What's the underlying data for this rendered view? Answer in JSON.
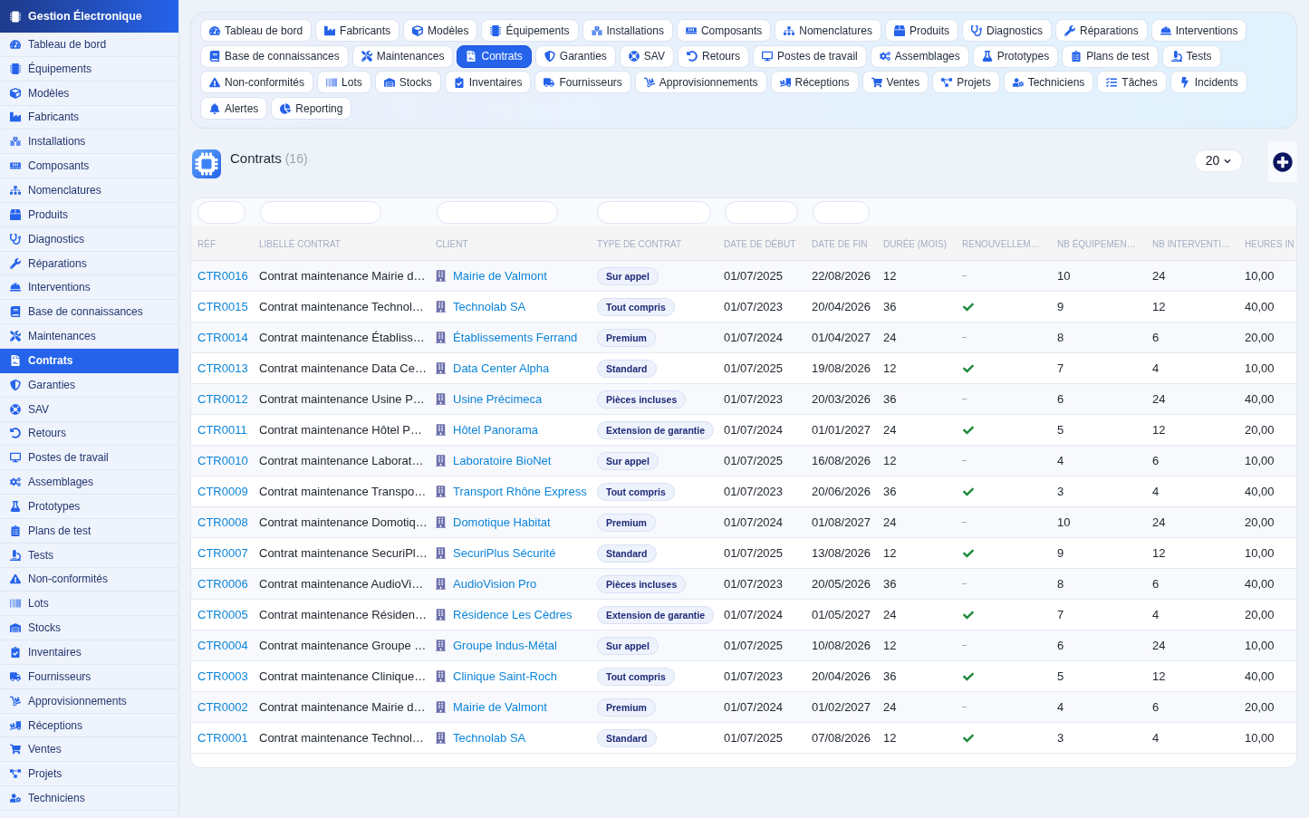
{
  "sidebar": {
    "title": "Gestion Électronique",
    "items": [
      {
        "label": "Tableau de bord",
        "selected": false
      },
      {
        "label": "Équipements",
        "selected": false
      },
      {
        "label": "Modèles",
        "selected": false
      },
      {
        "label": "Fabricants",
        "selected": false
      },
      {
        "label": "Installations",
        "selected": false
      },
      {
        "label": "Composants",
        "selected": false
      },
      {
        "label": "Nomenclatures",
        "selected": false
      },
      {
        "label": "Produits",
        "selected": false
      },
      {
        "label": "Diagnostics",
        "selected": false
      },
      {
        "label": "Réparations",
        "selected": false
      },
      {
        "label": "Interventions",
        "selected": false
      },
      {
        "label": "Base de connaissances",
        "selected": false
      },
      {
        "label": "Maintenances",
        "selected": false
      },
      {
        "label": "Contrats",
        "selected": true
      },
      {
        "label": "Garanties",
        "selected": false
      },
      {
        "label": "SAV",
        "selected": false
      },
      {
        "label": "Retours",
        "selected": false
      },
      {
        "label": "Postes de travail",
        "selected": false
      },
      {
        "label": "Assemblages",
        "selected": false
      },
      {
        "label": "Prototypes",
        "selected": false
      },
      {
        "label": "Plans de test",
        "selected": false
      },
      {
        "label": "Tests",
        "selected": false
      },
      {
        "label": "Non-conformités",
        "selected": false
      },
      {
        "label": "Lots",
        "selected": false
      },
      {
        "label": "Stocks",
        "selected": false
      },
      {
        "label": "Inventaires",
        "selected": false
      },
      {
        "label": "Fournisseurs",
        "selected": false
      },
      {
        "label": "Approvisionnements",
        "selected": false
      },
      {
        "label": "Réceptions",
        "selected": false
      },
      {
        "label": "Ventes",
        "selected": false
      },
      {
        "label": "Projets",
        "selected": false
      },
      {
        "label": "Techniciens",
        "selected": false
      }
    ]
  },
  "tabs": [
    {
      "label": "Tableau de bord",
      "selected": false
    },
    {
      "label": "Fabricants",
      "selected": false
    },
    {
      "label": "Modèles",
      "selected": false
    },
    {
      "label": "Équipements",
      "selected": false
    },
    {
      "label": "Installations",
      "selected": false
    },
    {
      "label": "Composants",
      "selected": false
    },
    {
      "label": "Nomenclatures",
      "selected": false
    },
    {
      "label": "Produits",
      "selected": false
    },
    {
      "label": "Diagnostics",
      "selected": false
    },
    {
      "label": "Réparations",
      "selected": false
    },
    {
      "label": "Interventions",
      "selected": false
    },
    {
      "label": "Base de connaissances",
      "selected": false
    },
    {
      "label": "Maintenances",
      "selected": false
    },
    {
      "label": "Contrats",
      "selected": true
    },
    {
      "label": "Garanties",
      "selected": false
    },
    {
      "label": "SAV",
      "selected": false
    },
    {
      "label": "Retours",
      "selected": false
    },
    {
      "label": "Postes de travail",
      "selected": false
    },
    {
      "label": "Assemblages",
      "selected": false
    },
    {
      "label": "Prototypes",
      "selected": false
    },
    {
      "label": "Plans de test",
      "selected": false
    },
    {
      "label": "Tests",
      "selected": false
    },
    {
      "label": "Non-conformités",
      "selected": false
    },
    {
      "label": "Lots",
      "selected": false
    },
    {
      "label": "Stocks",
      "selected": false
    },
    {
      "label": "Inventaires",
      "selected": false
    },
    {
      "label": "Fournisseurs",
      "selected": false
    },
    {
      "label": "Approvisionnements",
      "selected": false
    },
    {
      "label": "Réceptions",
      "selected": false
    },
    {
      "label": "Ventes",
      "selected": false
    },
    {
      "label": "Projets",
      "selected": false
    },
    {
      "label": "Techniciens",
      "selected": false
    },
    {
      "label": "Tâches",
      "selected": false
    },
    {
      "label": "Incidents",
      "selected": false
    },
    {
      "label": "Alertes",
      "selected": false
    },
    {
      "label": "Reporting",
      "selected": false
    }
  ],
  "heading": {
    "title": "Contrats",
    "count": "(16)"
  },
  "page_size": "20",
  "table": {
    "columns": [
      {
        "label": "RÉF",
        "filter": true
      },
      {
        "label": "LIBELLÉ CONTRAT",
        "filter": true
      },
      {
        "label": "CLIENT",
        "filter": true
      },
      {
        "label": "TYPE DE CONTRAT",
        "filter": true
      },
      {
        "label": "DATE DE DÉBUT",
        "filter": true
      },
      {
        "label": "DATE DE FIN",
        "filter": true
      },
      {
        "label": "DURÉE (MOIS)",
        "filter": false
      },
      {
        "label": "RENOUVELLEM…",
        "filter": false
      },
      {
        "label": "NB ÉQUIPEMEN…",
        "filter": false
      },
      {
        "label": "NB INTERVENTI…",
        "filter": false
      },
      {
        "label": "HEURES IN",
        "filter": false
      }
    ],
    "rows": [
      {
        "ref": "CTR0016",
        "label": "Contrat maintenance Mairie d…",
        "client": "Mairie de Valmont",
        "type": "Sur appel",
        "start_date": "01/07/2025",
        "end_date": "22/08/2026",
        "duration": "12",
        "renewal": false,
        "equipment_count": "10",
        "intervention_count": "24",
        "hours": "10,00"
      },
      {
        "ref": "CTR0015",
        "label": "Contrat maintenance Technol…",
        "client": "Technolab SA",
        "type": "Tout compris",
        "start_date": "01/07/2023",
        "end_date": "20/04/2026",
        "duration": "36",
        "renewal": true,
        "equipment_count": "9",
        "intervention_count": "12",
        "hours": "40,00"
      },
      {
        "ref": "CTR0014",
        "label": "Contrat maintenance Établiss…",
        "client": "Établissements Ferrand",
        "type": "Premium",
        "start_date": "01/07/2024",
        "end_date": "01/04/2027",
        "duration": "24",
        "renewal": false,
        "equipment_count": "8",
        "intervention_count": "6",
        "hours": "20,00"
      },
      {
        "ref": "CTR0013",
        "label": "Contrat maintenance Data Ce…",
        "client": "Data Center Alpha",
        "type": "Standard",
        "start_date": "01/07/2025",
        "end_date": "19/08/2026",
        "duration": "12",
        "renewal": true,
        "equipment_count": "7",
        "intervention_count": "4",
        "hours": "10,00"
      },
      {
        "ref": "CTR0012",
        "label": "Contrat maintenance Usine P…",
        "client": "Usine Précimeca",
        "type": "Pièces incluses",
        "start_date": "01/07/2023",
        "end_date": "20/03/2026",
        "duration": "36",
        "renewal": false,
        "equipment_count": "6",
        "intervention_count": "24",
        "hours": "40,00"
      },
      {
        "ref": "CTR0011",
        "label": "Contrat maintenance Hôtel P…",
        "client": "Hôtel Panorama",
        "type": "Extension de garantie",
        "start_date": "01/07/2024",
        "end_date": "01/01/2027",
        "duration": "24",
        "renewal": true,
        "equipment_count": "5",
        "intervention_count": "12",
        "hours": "20,00"
      },
      {
        "ref": "CTR0010",
        "label": "Contrat maintenance Laborat…",
        "client": "Laboratoire BioNet",
        "type": "Sur appel",
        "start_date": "01/07/2025",
        "end_date": "16/08/2026",
        "duration": "12",
        "renewal": false,
        "equipment_count": "4",
        "intervention_count": "6",
        "hours": "10,00"
      },
      {
        "ref": "CTR0009",
        "label": "Contrat maintenance Transpo…",
        "client": "Transport Rhône Express",
        "type": "Tout compris",
        "start_date": "01/07/2023",
        "end_date": "20/06/2026",
        "duration": "36",
        "renewal": true,
        "equipment_count": "3",
        "intervention_count": "4",
        "hours": "40,00"
      },
      {
        "ref": "CTR0008",
        "label": "Contrat maintenance Domotiq…",
        "client": "Domotique Habitat",
        "type": "Premium",
        "start_date": "01/07/2024",
        "end_date": "01/08/2027",
        "duration": "24",
        "renewal": false,
        "equipment_count": "10",
        "intervention_count": "24",
        "hours": "20,00"
      },
      {
        "ref": "CTR0007",
        "label": "Contrat maintenance SecuriPl…",
        "client": "SecuriPlus Sécurité",
        "type": "Standard",
        "start_date": "01/07/2025",
        "end_date": "13/08/2026",
        "duration": "12",
        "renewal": true,
        "equipment_count": "9",
        "intervention_count": "12",
        "hours": "10,00"
      },
      {
        "ref": "CTR0006",
        "label": "Contrat maintenance AudioVi…",
        "client": "AudioVision Pro",
        "type": "Pièces incluses",
        "start_date": "01/07/2023",
        "end_date": "20/05/2026",
        "duration": "36",
        "renewal": false,
        "equipment_count": "8",
        "intervention_count": "6",
        "hours": "40,00"
      },
      {
        "ref": "CTR0005",
        "label": "Contrat maintenance Résiden…",
        "client": "Résidence Les Cèdres",
        "type": "Extension de garantie",
        "start_date": "01/07/2024",
        "end_date": "01/05/2027",
        "duration": "24",
        "renewal": true,
        "equipment_count": "7",
        "intervention_count": "4",
        "hours": "20,00"
      },
      {
        "ref": "CTR0004",
        "label": "Contrat maintenance Groupe …",
        "client": "Groupe Indus-Métal",
        "type": "Sur appel",
        "start_date": "01/07/2025",
        "end_date": "10/08/2026",
        "duration": "12",
        "renewal": false,
        "equipment_count": "6",
        "intervention_count": "24",
        "hours": "10,00"
      },
      {
        "ref": "CTR0003",
        "label": "Contrat maintenance Clinique…",
        "client": "Clinique Saint-Roch",
        "type": "Tout compris",
        "start_date": "01/07/2023",
        "end_date": "20/04/2026",
        "duration": "36",
        "renewal": true,
        "equipment_count": "5",
        "intervention_count": "12",
        "hours": "40,00"
      },
      {
        "ref": "CTR0002",
        "label": "Contrat maintenance Mairie d…",
        "client": "Mairie de Valmont",
        "type": "Premium",
        "start_date": "01/07/2024",
        "end_date": "01/02/2027",
        "duration": "24",
        "renewal": false,
        "equipment_count": "4",
        "intervention_count": "6",
        "hours": "20,00"
      },
      {
        "ref": "CTR0001",
        "label": "Contrat maintenance Technol…",
        "client": "Technolab SA",
        "type": "Standard",
        "start_date": "01/07/2025",
        "end_date": "07/08/2026",
        "duration": "12",
        "renewal": true,
        "equipment_count": "3",
        "intervention_count": "4",
        "hours": "10,00"
      }
    ]
  }
}
